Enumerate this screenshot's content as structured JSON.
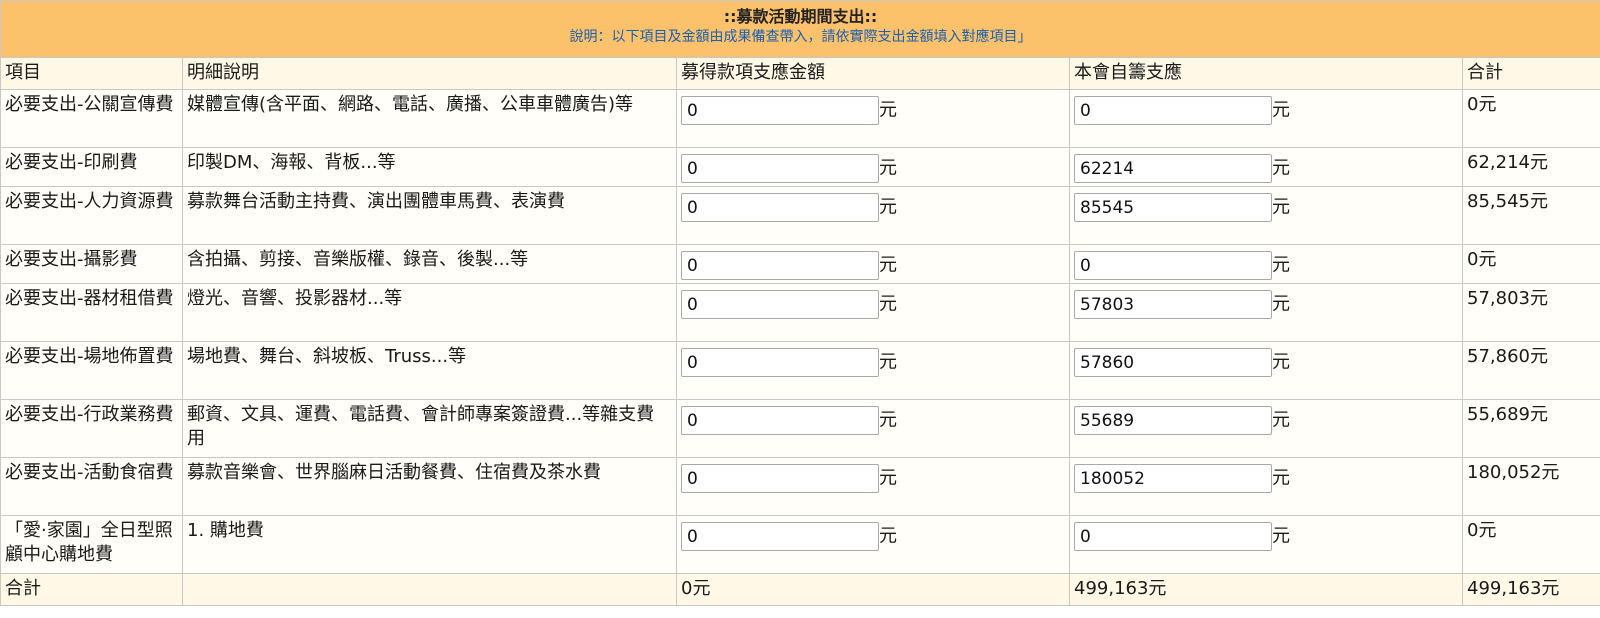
{
  "header": {
    "title": "::募款活動期間支出::",
    "description": "說明：以下項目及金額由成果備查帶入，請依實際支出金額填入對應項目」"
  },
  "columns": [
    "項目",
    "明細說明",
    "募得款項支應金額",
    "本會自籌支應",
    "合計"
  ],
  "unit": "元",
  "rows": [
    {
      "item": "必要支出-公關宣傳費",
      "detail": "媒體宣傳(含平面、網路、電話、廣播、公車車體廣告)等",
      "raised": "0",
      "self": "0",
      "total": "0元"
    },
    {
      "item": "必要支出-印刷費",
      "detail": "印製DM、海報、背板...等",
      "raised": "0",
      "self": "62214",
      "total": "62,214元"
    },
    {
      "item": "必要支出-人力資源費",
      "detail": "募款舞台活動主持費、演出團體車馬費、表演費",
      "raised": "0",
      "self": "85545",
      "total": "85,545元"
    },
    {
      "item": "必要支出-攝影費",
      "detail": "含拍攝、剪接、音樂版權、錄音、後製...等",
      "raised": "0",
      "self": "0",
      "total": "0元"
    },
    {
      "item": "必要支出-器材租借費",
      "detail": "燈光、音響、投影器材...等",
      "raised": "0",
      "self": "57803",
      "total": "57,803元"
    },
    {
      "item": "必要支出-場地佈置費",
      "detail": "場地費、舞台、斜坡板、Truss...等",
      "raised": "0",
      "self": "57860",
      "total": "57,860元"
    },
    {
      "item": "必要支出-行政業務費",
      "detail": "郵資、文具、運費、電話費、會計師專案簽證費...等雜支費用",
      "raised": "0",
      "self": "55689",
      "total": "55,689元"
    },
    {
      "item": "必要支出-活動食宿費",
      "detail": "募款音樂會、世界腦麻日活動餐費、住宿費及茶水費",
      "raised": "0",
      "self": "180052",
      "total": "180,052元"
    },
    {
      "item": "「愛·家園」全日型照顧中心購地費",
      "detail": "1. 購地費",
      "raised": "0",
      "self": "0",
      "total": "0元"
    }
  ],
  "totals": {
    "label": "合計",
    "raised": "0元",
    "self": "499,163元",
    "grand": "499,163元"
  }
}
